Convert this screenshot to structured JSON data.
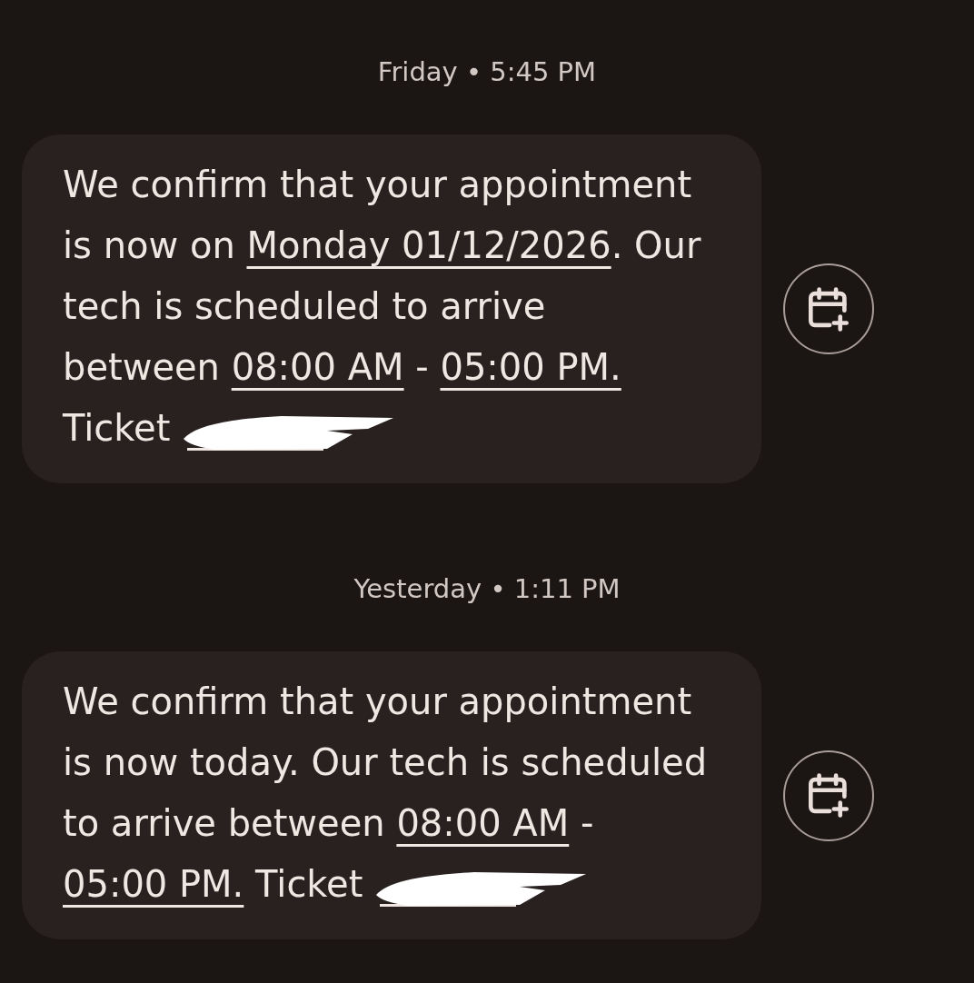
{
  "messages": [
    {
      "timestamp": "Friday • 5:45 PM",
      "body": [
        {
          "kind": "text",
          "text": "We confirm that your appointment is now on "
        },
        {
          "kind": "date",
          "text": "Monday 01/12/2026"
        },
        {
          "kind": "text",
          "text": ". Our tech is scheduled to arrive between "
        },
        {
          "kind": "time",
          "text": "08:00 AM"
        },
        {
          "kind": "text",
          "text": " - "
        },
        {
          "kind": "time",
          "text": "05:00 PM."
        },
        {
          "kind": "text",
          "text": " Ticket "
        },
        {
          "kind": "redacted"
        }
      ]
    },
    {
      "timestamp": "Yesterday • 1:11 PM",
      "body": [
        {
          "kind": "text",
          "text": "We confirm that your appointment is now today. Our tech is scheduled to arrive between "
        },
        {
          "kind": "time",
          "text": "08:00 AM"
        },
        {
          "kind": "text",
          "text": " - "
        },
        {
          "kind": "time",
          "text": "05:00 PM."
        },
        {
          "kind": "text",
          "text": " Ticket "
        },
        {
          "kind": "redacted"
        }
      ]
    }
  ]
}
